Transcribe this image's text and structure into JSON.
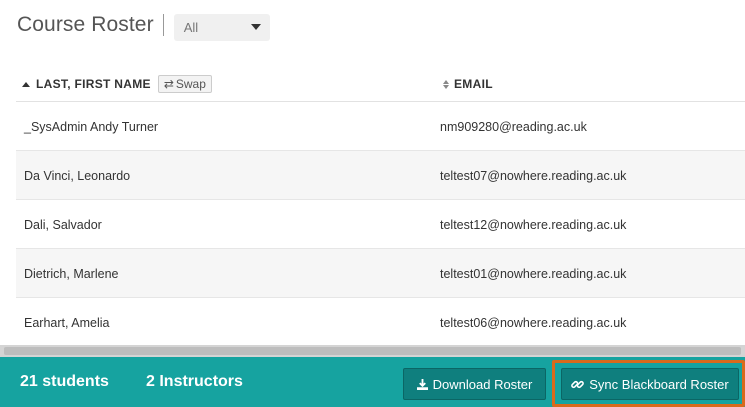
{
  "header": {
    "title": "Course Roster",
    "filter": {
      "selected": "All"
    }
  },
  "table": {
    "columns": {
      "name": "LAST, FIRST NAME",
      "swap_label": "Swap",
      "email": "EMAIL"
    },
    "rows": [
      {
        "name": "_SysAdmin Andy Turner",
        "email": "nm909280@reading.ac.uk"
      },
      {
        "name": "Da Vinci, Leonardo",
        "email": "teltest07@nowhere.reading.ac.uk"
      },
      {
        "name": "Dali, Salvador",
        "email": "teltest12@nowhere.reading.ac.uk"
      },
      {
        "name": "Dietrich, Marlene",
        "email": "teltest01@nowhere.reading.ac.uk"
      },
      {
        "name": "Earhart, Amelia",
        "email": "teltest06@nowhere.reading.ac.uk"
      }
    ]
  },
  "footer": {
    "students_count": "21 students",
    "instructors_count": "2 Instructors",
    "download_label": "Download Roster",
    "sync_label": "Sync Blackboard Roster"
  },
  "colors": {
    "footer_bg": "#16a3a0",
    "button_bg": "#0f7f7e",
    "highlight": "#d96a1c"
  },
  "icons": {
    "download": "download-icon",
    "link": "link-icon",
    "swap": "swap-icon"
  }
}
